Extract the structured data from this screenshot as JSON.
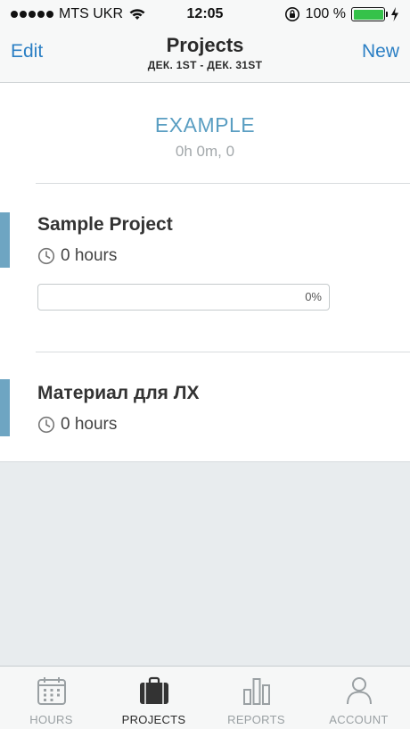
{
  "status_bar": {
    "carrier": "MTS UKR",
    "time": "12:05",
    "battery": "100 %",
    "battery_level": 1.0
  },
  "nav": {
    "left_button": "Edit",
    "title": "Projects",
    "subtitle": "ДЕК. 1ST - ДЕК. 31ST",
    "right_button": "New"
  },
  "client": {
    "name": "EXAMPLE",
    "meta": "0h 0m, 0"
  },
  "projects": [
    {
      "name": "Sample Project",
      "hours": "0 hours",
      "progress_label": "0%",
      "progress": 0,
      "accent": "#6ea5c2"
    },
    {
      "name": "Материал для ЛХ",
      "hours": "0 hours",
      "accent": "#6ea5c2"
    }
  ],
  "tabs": [
    {
      "label": "HOURS",
      "icon": "calendar-icon",
      "active": false
    },
    {
      "label": "PROJECTS",
      "icon": "briefcase-icon",
      "active": true
    },
    {
      "label": "REPORTS",
      "icon": "bar-chart-icon",
      "active": false
    },
    {
      "label": "ACCOUNT",
      "icon": "person-icon",
      "active": false
    }
  ],
  "colors": {
    "accent": "#2b7fc4",
    "project_accent": "#6ea5c2",
    "battery": "#35c24a"
  }
}
